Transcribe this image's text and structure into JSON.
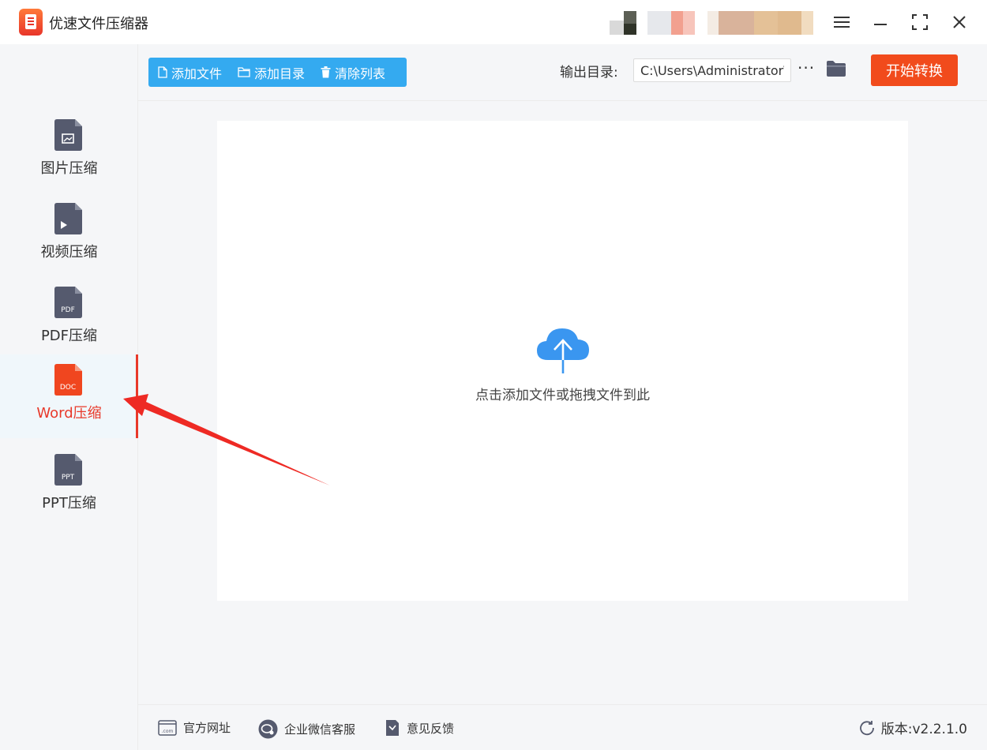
{
  "app": {
    "title": "优速文件压缩器"
  },
  "sidebar": {
    "items": [
      {
        "label": "图片压缩",
        "icon": "image-file-icon",
        "badge": ""
      },
      {
        "label": "视频压缩",
        "icon": "video-file-icon",
        "badge": ""
      },
      {
        "label": "PDF压缩",
        "icon": "pdf-file-icon",
        "badge": "PDF"
      },
      {
        "label": "Word压缩",
        "icon": "doc-file-icon",
        "badge": "DOC",
        "active": true
      },
      {
        "label": "PPT压缩",
        "icon": "ppt-file-icon",
        "badge": "PPT"
      }
    ]
  },
  "toolbar": {
    "add_file": "添加文件",
    "add_folder": "添加目录",
    "clear_list": "清除列表",
    "output_label": "输出目录:",
    "output_path": "C:\\Users\\Administrator\\",
    "more": "···",
    "start": "开始转换"
  },
  "dropzone": {
    "hint": "点击添加文件或拖拽文件到此"
  },
  "footer": {
    "website": "官方网址",
    "wechat": "企业微信客服",
    "feedback": "意见反馈",
    "version": "版本:v2.2.1.0"
  },
  "colors": {
    "accent_blue": "#34aaf0",
    "accent_red": "#e8392a",
    "start_button": "#f14b1c",
    "icon_gray": "#555a6e",
    "cloud_blue": "#3a96f0"
  }
}
